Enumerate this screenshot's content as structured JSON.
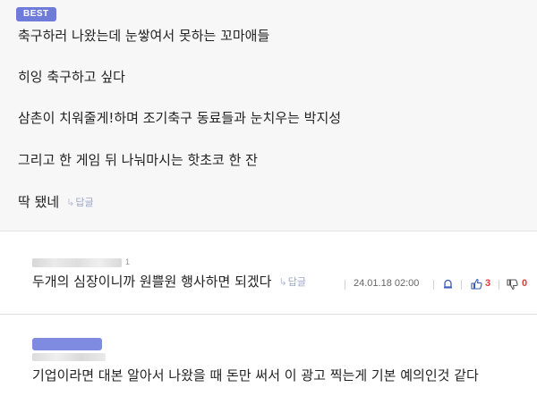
{
  "best_comment": {
    "badge": "BEST",
    "lines": [
      "축구하러 나왔는데 눈쌓여서 못하는 꼬마애들",
      "히잉 축구하고 싶다",
      "삼촌이 치워줄게!하며 조기축구 동료들과 눈치우는 박지성",
      "그리고 한 게임 뒤 나눠마시는 핫초코 한 잔",
      "딱 됐네"
    ],
    "reply_label": "답글"
  },
  "reply_1": {
    "name_tail": "1",
    "text": "두개의 심장이니까 원쁠원 행사하면 되겠다",
    "reply_label": "답글",
    "timestamp": "24.01.18 02:00",
    "likes": "3",
    "dislikes": "0",
    "icons": [
      "report-icon",
      "thumbs-up-icon",
      "thumbs-down-icon"
    ]
  },
  "reply_2": {
    "text": "기업이라면 대본 알아서 나왔을 때 돈만 써서 이 광고 찍는게 기본 예의인것 같다"
  },
  "colors": {
    "badge": "#6f7bd9",
    "count": "#e03b3b",
    "reply_link": "#9aa6c8"
  }
}
